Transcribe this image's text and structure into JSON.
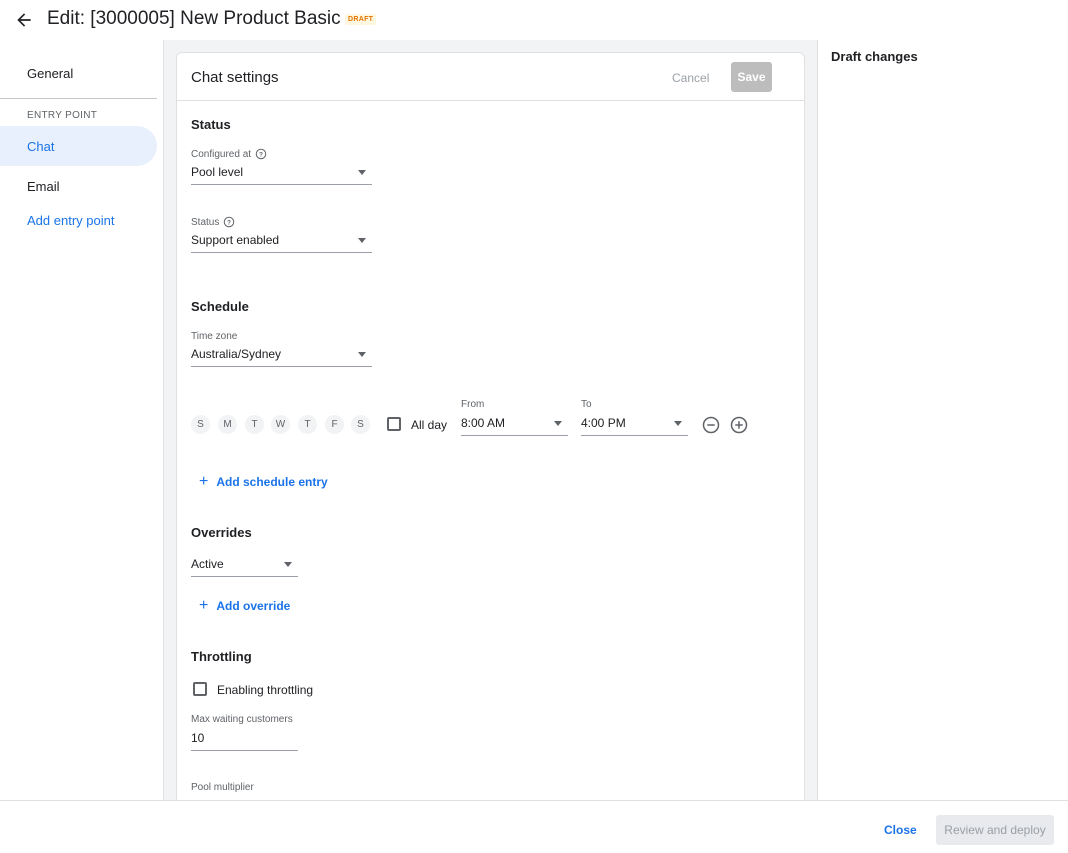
{
  "header": {
    "title": "Edit: [3000005] New Product Basic",
    "badge": "DRAFT",
    "back_icon": "arrow-back-icon"
  },
  "nav": {
    "general": "General",
    "section_label": "ENTRY POINT",
    "chat": "Chat",
    "email": "Email",
    "add_entry": "Add entry point"
  },
  "card": {
    "title": "Chat settings",
    "cancel": "Cancel",
    "save": "Save"
  },
  "status_section": {
    "title": "Status",
    "configured_label": "Configured at",
    "configured_value": "Pool level",
    "status_label": "Status",
    "status_value": "Support enabled"
  },
  "schedule": {
    "title": "Schedule",
    "timezone_label": "Time zone",
    "timezone_value": "Australia/Sydney",
    "days": [
      "S",
      "M",
      "T",
      "W",
      "T",
      "F",
      "S"
    ],
    "all_day": "All day",
    "from_label": "From",
    "from_value": "8:00 AM",
    "to_label": "To",
    "to_value": "4:00 PM",
    "add_entry": "Add schedule entry"
  },
  "overrides": {
    "title": "Overrides",
    "value": "Active",
    "add": "Add override"
  },
  "throttling": {
    "title": "Throttling",
    "enable_label": "Enabling throttling",
    "max_waiting_label": "Max waiting customers",
    "max_waiting_value": "10",
    "pool_multiplier_label": "Pool multiplier"
  },
  "right_panel": {
    "title": "Draft changes"
  },
  "footer": {
    "close": "Close",
    "deploy": "Review and deploy"
  },
  "colors": {
    "accent": "#1a73e8",
    "badge_bg": "#fef7e0",
    "badge_text": "#e37400"
  }
}
